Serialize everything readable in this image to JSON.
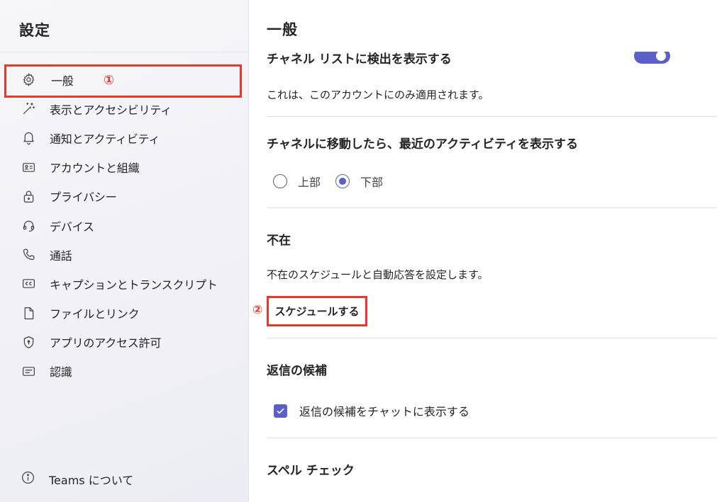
{
  "sidebar": {
    "title": "設定",
    "items": [
      {
        "label": "一般",
        "icon": "gear-icon"
      },
      {
        "label": "表示とアクセシビリティ",
        "icon": "magic-wand-icon"
      },
      {
        "label": "通知とアクティビティ",
        "icon": "bell-icon"
      },
      {
        "label": "アカウントと組織",
        "icon": "id-card-icon"
      },
      {
        "label": "プライバシー",
        "icon": "lock-icon"
      },
      {
        "label": "デバイス",
        "icon": "headset-icon"
      },
      {
        "label": "通話",
        "icon": "phone-icon"
      },
      {
        "label": "キャプションとトランスクリプト",
        "icon": "cc-icon"
      },
      {
        "label": "ファイルとリンク",
        "icon": "document-icon"
      },
      {
        "label": "アプリのアクセス許可",
        "icon": "shield-icon"
      },
      {
        "label": "認識",
        "icon": "text-box-icon"
      }
    ],
    "about_label": "Teams について",
    "active_index": 0
  },
  "annotations": {
    "marker_1": "①",
    "marker_2": "②",
    "highlight_color": "#e8382d"
  },
  "main": {
    "header": "一般",
    "channel_list": {
      "heading": "チャネル リストに検出を表示する",
      "toggle_on": true,
      "note": "これは、このアカウントにのみ適用されます。"
    },
    "recent_activity": {
      "heading": "チャネルに移動したら、最近のアクティビティを表示する",
      "options": [
        "上部",
        "下部"
      ],
      "selected": "下部"
    },
    "away": {
      "heading": "不在",
      "description": "不在のスケジュールと自動応答を設定します。",
      "button_label": "スケジュールする"
    },
    "reply_suggestions": {
      "heading": "返信の候補",
      "checkbox_label": "返信の候補をチャットに表示する",
      "checked": true
    },
    "spell_check": {
      "heading": "スペル チェック"
    }
  },
  "colors": {
    "accent": "#5b5fc7",
    "sidebar_bg": "#f1f1f6",
    "text": "#242424"
  }
}
